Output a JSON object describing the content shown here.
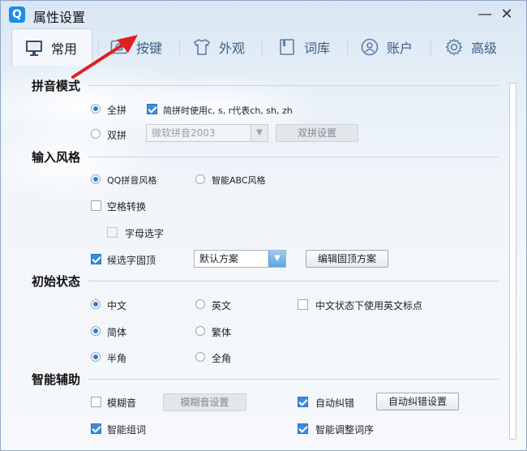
{
  "window": {
    "title": "属性设置",
    "app_icon": "Q"
  },
  "tabs": [
    {
      "label": "常用",
      "icon": "monitor-icon",
      "active": true
    },
    {
      "label": "按键",
      "icon": "keyboard-q-icon",
      "active": false
    },
    {
      "label": "外观",
      "icon": "tshirt-icon",
      "active": false
    },
    {
      "label": "词库",
      "icon": "book-icon",
      "active": false
    },
    {
      "label": "账户",
      "icon": "user-icon",
      "active": false
    },
    {
      "label": "高级",
      "icon": "gear-icon",
      "active": false
    }
  ],
  "sections": {
    "pinyin_mode": {
      "title": "拼音模式",
      "quanpin": "全拼",
      "jianpin_option": "简拼时使用c, s, r代表ch, sh, zh",
      "shuangpin": "双拼",
      "shuangpin_scheme": "微软拼音2003",
      "shuangpin_settings": "双拼设置"
    },
    "input_style": {
      "title": "输入风格",
      "qq_style": "QQ拼音风格",
      "abc_style": "智能ABC风格",
      "space_convert": "空格转换",
      "letter_select": "字母选字",
      "fixed_candidate": "候选字固顶",
      "fixed_scheme": "默认方案",
      "edit_fixed": "编辑固顶方案"
    },
    "initial_state": {
      "title": "初始状态",
      "chinese": "中文",
      "english": "英文",
      "en_punct": "中文状态下使用英文标点",
      "simplified": "简体",
      "traditional": "繁体",
      "half_width": "半角",
      "full_width": "全角"
    },
    "smart_assist": {
      "title": "智能辅助",
      "fuzzy": "模糊音",
      "fuzzy_settings": "模糊音设置",
      "autocorrect": "自动纠错",
      "autocorrect_settings": "自动纠错设置",
      "smart_phrase": "智能组词",
      "smart_order": "智能调整词序"
    }
  },
  "colors": {
    "accent": "#2a7fd4",
    "annotation_arrow": "#e02020"
  }
}
